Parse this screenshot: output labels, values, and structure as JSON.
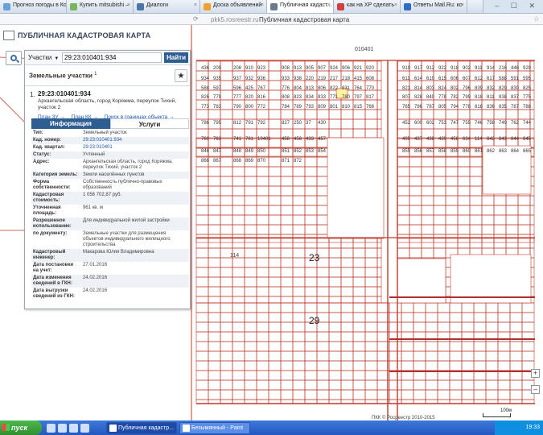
{
  "browser": {
    "tabs": [
      {
        "label": "Прогноз погоды в Ко",
        "active": false,
        "color": "#6aa0d8"
      },
      {
        "label": "Купить mitsubishi –",
        "active": false,
        "color": "#7bb55b"
      },
      {
        "label": "Диалоги",
        "active": false,
        "color": "#4a76a8"
      },
      {
        "label": "Доска объявлений",
        "active": false,
        "color": "#f0a030"
      },
      {
        "label": "Публичная кадаст...",
        "active": true,
        "color": "#6b7b8c"
      },
      {
        "label": "как на ХР сделать",
        "active": false,
        "color": "#d04040"
      },
      {
        "label": "Ответы Mail.Ru: ко",
        "active": false,
        "color": "#2e6bc4"
      },
      {
        "label": "",
        "active": false,
        "color": "#cccccc"
      }
    ],
    "url": "pkk5.rosreestr.ru",
    "page_title": "Публичная кадастровая карта",
    "window_controls": "– ☐ ✕"
  },
  "header": {
    "title": "ПУБЛИЧНАЯ КАДАСТРОВАЯ КАРТА"
  },
  "search": {
    "type_label": "Участки",
    "value": "29:23:010401:934",
    "button": "Найти"
  },
  "results": {
    "title": "Земельные участки",
    "count": "1",
    "pin": "★",
    "item": {
      "num": "1.",
      "cad_number": "29:23:010401:934",
      "address": "Архангельская область, город Коряжма, переулок Тихий, участок 2",
      "links": [
        "План ЗУ →",
        "План КК →",
        "Поиск в границах объекта →"
      ]
    },
    "tabs": [
      "Информация",
      "Услуги"
    ],
    "info": [
      {
        "k": "Тип:",
        "v": "Земельный участок"
      },
      {
        "k": "Кад. номер:",
        "v": "29:23:010401:934",
        "link": true
      },
      {
        "k": "Кад. квартал:",
        "v": "29:23:010401",
        "link": true
      },
      {
        "k": "Статус:",
        "v": "Учтенный"
      },
      {
        "k": "Адрес:",
        "v": "Архангельская область, город Коряжма, переулок Тихий, участок 2"
      },
      {
        "k": "Категория земель:",
        "v": "Земли населённых пунктов"
      },
      {
        "k": "Форма собственности:",
        "v": "Собственность публично-правовых образований"
      },
      {
        "k": "Кадастровая стоимость:",
        "v": "1 056 702,87 руб."
      },
      {
        "k": "Уточненная площадь:",
        "v": "961 кв. м"
      },
      {
        "k": "Разрешенное использование:",
        "v": "Для индивидуальной жилой застройки"
      },
      {
        "k": "по документу:",
        "v": "Земельные участки для размещения объектов индивидуального жилищного строительства"
      },
      {
        "k": "Кадастровый инженер:",
        "v": "Макарова Юлия Владимировна"
      },
      {
        "k": "Дата постановки на учет:",
        "v": "27.01.2016"
      },
      {
        "k": "Дата изменения сведений в ГКН:",
        "v": "24.02.2016"
      },
      {
        "k": "Дата выгрузки сведений из ГКН:",
        "v": "24.02.2016"
      }
    ]
  },
  "map": {
    "quarter_label": "010401",
    "labels_big": [
      "23",
      "29"
    ],
    "parcel_numbers": [
      "436",
      "209",
      "208",
      "910",
      "923",
      "908",
      "913",
      "905",
      "907",
      "924",
      "906",
      "921",
      "920",
      "919",
      "917",
      "912",
      "922",
      "918",
      "902",
      "911",
      "914",
      "216",
      "446",
      "929",
      "934",
      "935",
      "937",
      "932",
      "936",
      "933",
      "938",
      "220",
      "219",
      "217",
      "218",
      "415",
      "608",
      "611",
      "614",
      "610",
      "615",
      "606",
      "607",
      "612",
      "617",
      "588",
      "591",
      "595",
      "588",
      "597",
      "596",
      "425",
      "767",
      "776",
      "804",
      "813",
      "806",
      "822",
      "831",
      "764",
      "770",
      "821",
      "814",
      "803",
      "824",
      "802",
      "796",
      "839",
      "832",
      "829",
      "830",
      "825",
      "826",
      "779",
      "777",
      "820",
      "816",
      "808",
      "823",
      "834",
      "833",
      "771",
      "780",
      "797",
      "817",
      "807",
      "828",
      "840",
      "778",
      "782",
      "799",
      "818",
      "811",
      "838",
      "837",
      "775",
      "773",
      "783",
      "790",
      "800",
      "772",
      "784",
      "789",
      "793",
      "809",
      "801",
      "810",
      "815",
      "766",
      "765",
      "786",
      "787",
      "805",
      "794",
      "778",
      "816",
      "836",
      "835",
      "787",
      "788",
      "786",
      "795",
      "812",
      "791",
      "792",
      "827",
      "250",
      "37",
      "430",
      "452",
      "600",
      "602",
      "753",
      "747",
      "755",
      "746",
      "758",
      "749",
      "762",
      "744",
      "760",
      "763",
      "741",
      "761",
      "10401",
      "458",
      "456",
      "433",
      "457",
      "405",
      "437",
      "438",
      "439",
      "456",
      "634",
      "114",
      "842",
      "843",
      "844",
      "845",
      "846",
      "847",
      "848",
      "849",
      "850",
      "851",
      "852",
      "853",
      "854",
      "855",
      "856",
      "857",
      "858",
      "859",
      "860",
      "861",
      "862",
      "863",
      "864",
      "865",
      "866",
      "867",
      "868",
      "869",
      "870",
      "871",
      "872"
    ],
    "copyright": "ПКК © Росреестр 2010-2015",
    "scale_label": "100м",
    "zoom_in": "+",
    "zoom_out": "–"
  },
  "taskbar": {
    "start": "пуск",
    "items": [
      {
        "label": "Публичная кадастр...",
        "active": true
      },
      {
        "label": "Безымянный - Paint",
        "active": false
      }
    ],
    "clock": "19:33"
  }
}
